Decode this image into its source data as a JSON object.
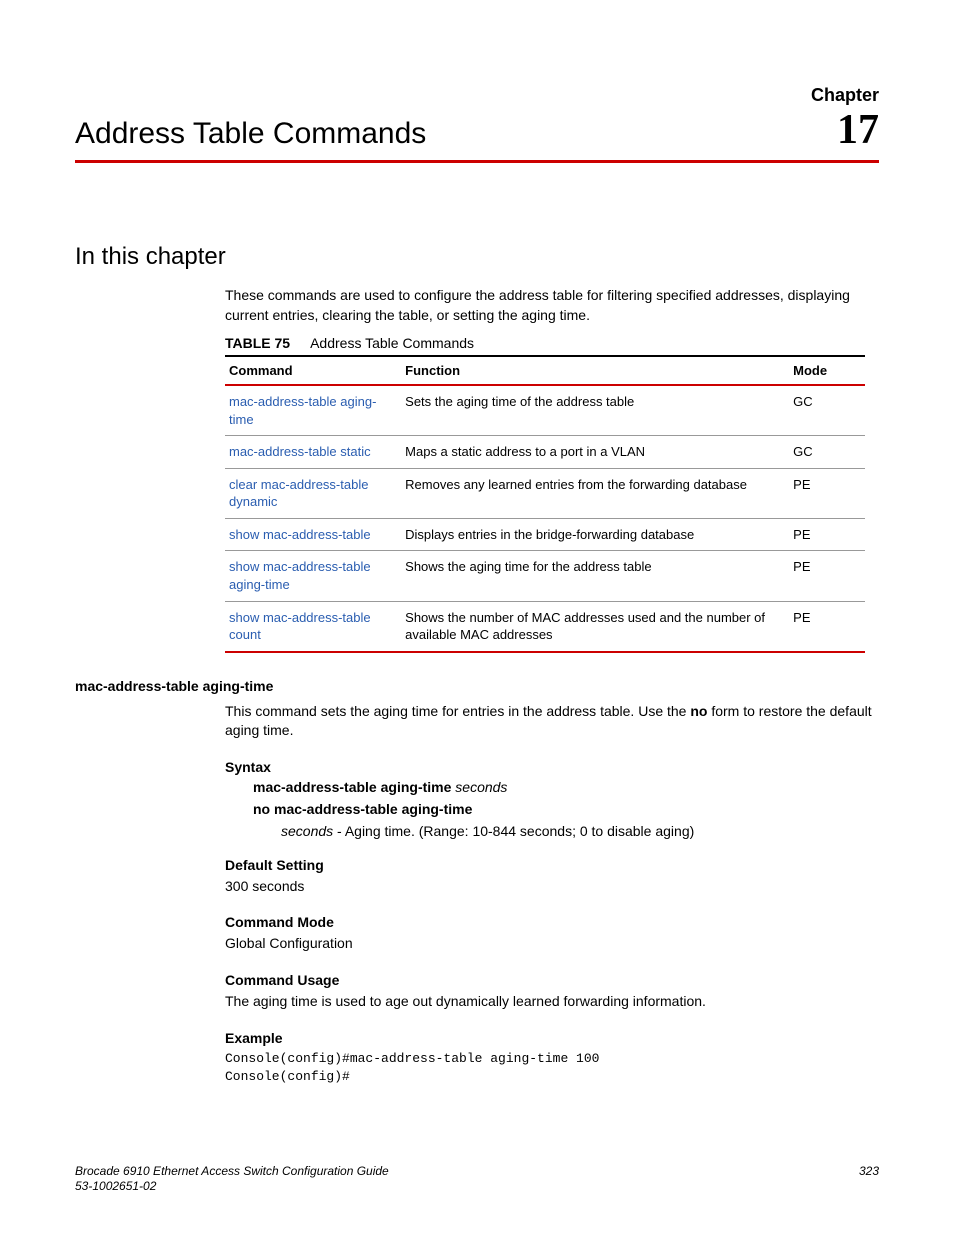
{
  "header": {
    "chapter_label": "Chapter",
    "title": "Address Table Commands",
    "number": "17"
  },
  "section": {
    "title": "In this chapter",
    "intro": "These commands are used to configure the address table for filtering specified addresses, displaying current entries, clearing the table, or setting the aging time."
  },
  "table": {
    "label": "TABLE 75",
    "caption": "Address Table Commands",
    "headers": {
      "c1": "Command",
      "c2": "Function",
      "c3": "Mode"
    },
    "rows": [
      {
        "cmd": "mac-address-table aging-time",
        "fn": "Sets the aging time of the address table",
        "mode": "GC"
      },
      {
        "cmd": "mac-address-table static",
        "fn": "Maps a static address to a port in a VLAN",
        "mode": "GC"
      },
      {
        "cmd": "clear mac-address-table dynamic",
        "fn": "Removes any learned entries from the forwarding database",
        "mode": "PE"
      },
      {
        "cmd": "show mac-address-table",
        "fn": "Displays entries in the bridge-forwarding database",
        "mode": "PE"
      },
      {
        "cmd": "show mac-address-table aging-time",
        "fn": "Shows the aging time for the address table",
        "mode": "PE"
      },
      {
        "cmd": "show mac-address-table count",
        "fn": "Shows the number of MAC addresses used and the number of available MAC addresses",
        "mode": "PE"
      }
    ]
  },
  "detail": {
    "name": "mac-address-table aging-time",
    "desc_pre": "This command sets the aging time for entries in the address table. Use the ",
    "desc_no": "no",
    "desc_post": " form to restore the default aging time.",
    "syntax_label": "Syntax",
    "syntax_cmd": "mac-address-table aging-time",
    "syntax_arg": "seconds",
    "syntax_no": "no mac-address-table aging-time",
    "arg_name": "seconds",
    "arg_desc": " - Aging time. (Range: 10-844 seconds; 0 to disable aging)",
    "default_label": "Default Setting",
    "default_val": "300 seconds",
    "mode_label": "Command Mode",
    "mode_val": "Global Configuration",
    "usage_label": "Command Usage",
    "usage_val": "The aging time is used to age out dynamically learned forwarding information.",
    "example_label": "Example",
    "example_code": "Console(config)#mac-address-table aging-time 100\nConsole(config)#"
  },
  "footer": {
    "title": "Brocade 6910 Ethernet Access Switch Configuration Guide",
    "docnum": "53-1002651-02",
    "page": "323"
  }
}
